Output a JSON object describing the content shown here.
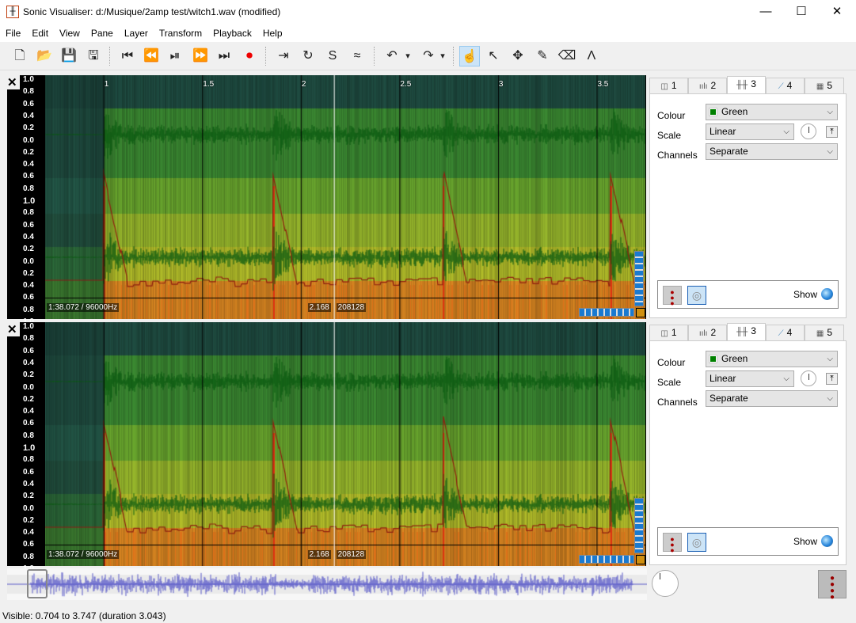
{
  "window": {
    "title": "Sonic Visualiser: d:/Musique/2amp test/witch1.wav (modified)",
    "minimize": "—",
    "maximize": "☐",
    "close": "✕"
  },
  "menu": [
    "File",
    "Edit",
    "View",
    "Pane",
    "Layer",
    "Transform",
    "Playback",
    "Help"
  ],
  "toolbar": [
    {
      "name": "new-icon",
      "glyph": "🗋"
    },
    {
      "name": "open-icon",
      "glyph": "📂"
    },
    {
      "name": "save-icon",
      "glyph": "💾"
    },
    {
      "name": "save-as-icon",
      "glyph": "🖫"
    },
    {
      "name": "rewind-start-icon",
      "glyph": "⏮"
    },
    {
      "name": "rewind-icon",
      "glyph": "⏪"
    },
    {
      "name": "play-pause-icon",
      "glyph": "⏯"
    },
    {
      "name": "fast-forward-icon",
      "glyph": "⏩"
    },
    {
      "name": "fast-forward-end-icon",
      "glyph": "⏭"
    },
    {
      "name": "record-icon",
      "glyph": "⏺"
    },
    {
      "name": "play-selection-icon",
      "glyph": "⇥"
    },
    {
      "name": "loop-icon",
      "glyph": "↻"
    },
    {
      "name": "solo-icon",
      "glyph": "S"
    },
    {
      "name": "speed-icon",
      "glyph": "≈"
    },
    {
      "name": "undo-icon",
      "glyph": "↶"
    },
    {
      "name": "undo-menu-icon",
      "glyph": "▾"
    },
    {
      "name": "redo-icon",
      "glyph": "↷"
    },
    {
      "name": "redo-menu-icon",
      "glyph": "▾"
    },
    {
      "name": "navigate-tool-icon",
      "glyph": "☝"
    },
    {
      "name": "select-tool-icon",
      "glyph": "↖"
    },
    {
      "name": "move-tool-icon",
      "glyph": "✥"
    },
    {
      "name": "draw-tool-icon",
      "glyph": "✎"
    },
    {
      "name": "erase-tool-icon",
      "glyph": "⌫"
    },
    {
      "name": "measure-tool-icon",
      "glyph": "Λ"
    }
  ],
  "ruler": [
    "1",
    "1.5",
    "2",
    "2.5",
    "3",
    "3.5"
  ],
  "ruler_times": [
    1,
    1.5,
    2,
    2.5,
    3,
    3.5
  ],
  "visible_range": [
    0.704,
    3.747
  ],
  "scale_labels": [
    "1.0",
    "0.8",
    "0.6",
    "0.4",
    "0.2",
    "0.0",
    "0.2",
    "0.4",
    "0.6",
    "0.8",
    "1.0",
    "0.8",
    "0.6",
    "0.4",
    "0.2",
    "0.0",
    "0.2",
    "0.4",
    "0.6",
    "0.8",
    "1.0"
  ],
  "panes": [
    {
      "info_left": "1:38.072 / 96000Hz",
      "info_time": "2.168",
      "info_frame": "208128"
    },
    {
      "info_left": "1:38.072 / 96000Hz",
      "info_time": "2.168",
      "info_frame": "208128"
    }
  ],
  "layer_tabs": [
    {
      "num": "1",
      "icon": "pane-icon",
      "glyph": "◫"
    },
    {
      "num": "2",
      "icon": "spectrum-icon",
      "glyph": "ıılı"
    },
    {
      "num": "3",
      "icon": "waveform-icon",
      "glyph": "╫╫"
    },
    {
      "num": "4",
      "icon": "time-value-icon",
      "glyph": "⟋"
    },
    {
      "num": "5",
      "icon": "colour-3d-icon",
      "glyph": "▦"
    }
  ],
  "properties": {
    "colour_label": "Colour",
    "colour": "Green",
    "colour_hex": "#008000",
    "scale_label": "Scale",
    "scale": "Linear",
    "channels_label": "Channels",
    "channels": "Separate",
    "show_label": "Show"
  },
  "status": "Visible: 0.704 to 3.747 (duration 3.043)"
}
